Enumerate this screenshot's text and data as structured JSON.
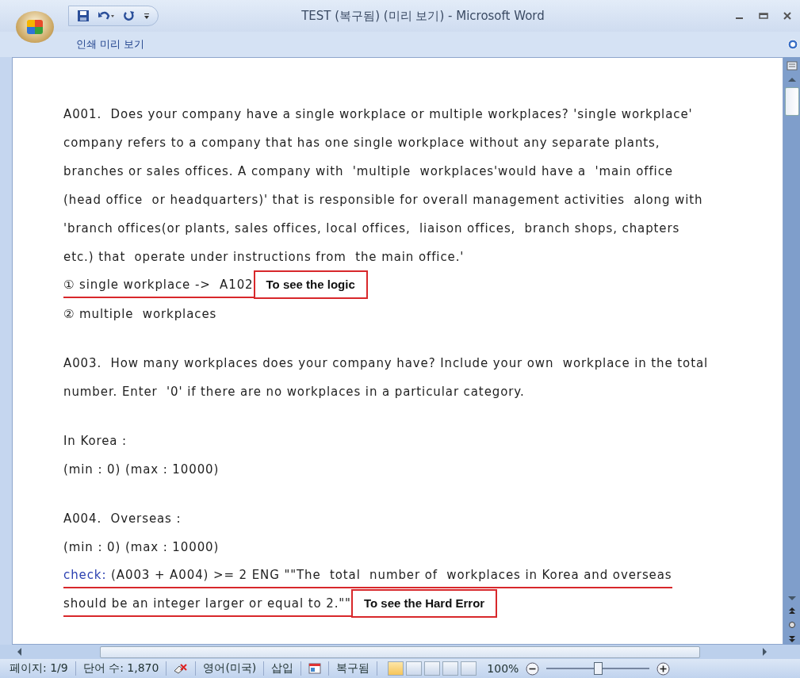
{
  "window": {
    "title": "TEST (복구됨) (미리 보기) - Microsoft Word"
  },
  "ribbon": {
    "tabs": [
      {
        "label": "인쇄 미리 보기",
        "selected": true
      }
    ]
  },
  "document": {
    "paragraphs": [
      {
        "lines": [
          {
            "kind": "text",
            "text": "A001.  Does your company have a single workplace or multiple workplaces? 'single workplace'",
            "underlined": false
          },
          {
            "kind": "text",
            "text": "company refers to a company that has one single workplace without any separate plants,",
            "underlined": false
          },
          {
            "kind": "text",
            "text": "branches or sales offices. A company with  'multiple  workplaces'would have a  'main office",
            "underlined": false
          },
          {
            "kind": "text",
            "text": "(head office  or headquarters)' that is responsible for overall management activities  along with",
            "underlined": false
          },
          {
            "kind": "text",
            "text": "'branch offices(or plants, sales offices, local offices,  liaison offices,  branch shops, chapters",
            "underlined": false
          },
          {
            "kind": "text",
            "text": "etc.) that  operate under instructions from  the main office.'",
            "underlined": false
          },
          {
            "kind": "text",
            "text": "① single workplace ->  A102",
            "underlined": true,
            "note": "To see the logic"
          },
          {
            "kind": "text",
            "text": "② multiple  workplaces",
            "underlined": false
          }
        ]
      },
      {
        "lines": [
          {
            "kind": "text",
            "text": "A003.  How many workplaces does your company have? Include your own  workplace in the total",
            "underlined": false
          },
          {
            "kind": "text",
            "text": "number. Enter  '0' if there are no workplaces in a particular category.",
            "underlined": false
          }
        ]
      },
      {
        "lines": [
          {
            "kind": "text",
            "text": "In Korea :",
            "underlined": false
          },
          {
            "kind": "text",
            "text": "(min : 0) (max : 10000)",
            "underlined": false
          }
        ]
      },
      {
        "lines": [
          {
            "kind": "text",
            "text": "A004.  Overseas :",
            "underlined": false
          },
          {
            "kind": "text",
            "text": "(min : 0) (max : 10000)",
            "underlined": false
          },
          {
            "kind": "check",
            "label": "check:",
            "text": "(A003 + A004) >= 2 ENG \"\"The  total  number of  workplaces in Korea and overseas",
            "underlined": true
          },
          {
            "kind": "text",
            "text": "should be an integer larger or equal to 2.\"\"",
            "underlined": true,
            "note": "To see the Hard Error"
          }
        ]
      }
    ]
  },
  "status_bar": {
    "page": "페이지: 1/9",
    "words": "단어 수: 1,870",
    "language": "영어(미국)",
    "mode": "삽입",
    "recovered": "복구됨",
    "zoom": "100%",
    "zoom_slider": {
      "level": 0.5
    }
  }
}
